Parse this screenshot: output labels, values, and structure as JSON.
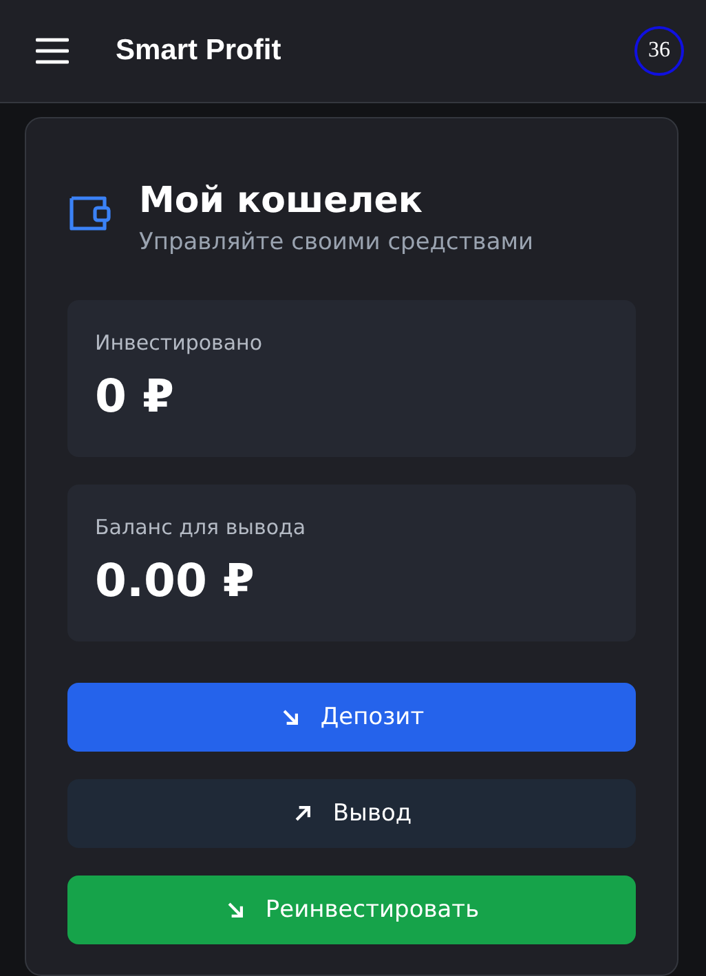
{
  "header": {
    "title": "Smart Profit",
    "badge": "36"
  },
  "wallet": {
    "title": "Мой кошелек",
    "subtitle": "Управляйте своими средствами",
    "stats": [
      {
        "label": "Инвестировано",
        "value": "0 ₽"
      },
      {
        "label": "Баланс для вывода",
        "value": "0.00 ₽"
      }
    ],
    "buttons": [
      {
        "label": "Депозит",
        "kind": "primary"
      },
      {
        "label": "Вывод",
        "kind": "secondary"
      },
      {
        "label": "Реинвестировать",
        "kind": "success"
      }
    ]
  }
}
